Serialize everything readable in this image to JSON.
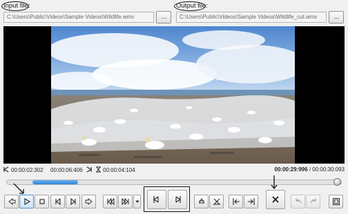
{
  "input": {
    "label": "Input file:",
    "path": "C:\\Users\\Public\\Videos\\Sample Videos\\Wildlife.wmv",
    "browse": "..."
  },
  "output": {
    "label": "Output file:",
    "path": "C:\\Users\\Public\\Videos\\Sample Videos\\Wildlife_cut.wmv",
    "browse": "..."
  },
  "times": {
    "start": "00:00:02:302",
    "end": "00:00:06:406",
    "duration": "00:00:04:104",
    "current": "00:00:29:996",
    "separator": "/",
    "total": "00:00:30:093"
  },
  "seekbar": {
    "selection_start_fraction": 0.077,
    "selection_end_fraction": 0.213,
    "position_fraction": 0.997
  },
  "icons": {
    "prev": "arrow-left-icon",
    "play": "play-icon",
    "stop": "stop-icon",
    "prev_frame": "previous-frame-icon",
    "next_frame": "next-frame-icon",
    "next": "arrow-right-icon",
    "skip_back": "skip-back-icon",
    "skip_forward": "skip-forward-icon",
    "speed": "dropdown-arrow-icon",
    "mark_in": "mark-in-icon",
    "mark_out": "mark-out-icon",
    "save_cut": "save-cut-icon",
    "clear": "clear-marks-icon",
    "go_in": "go-to-in-icon",
    "go_out": "go-to-out-icon",
    "cancel": "close-icon",
    "undo": "undo-icon",
    "redo": "redo-icon",
    "fullscreen": "fullscreen-icon"
  },
  "colors": {
    "accent": "#2e82d6",
    "background": "#f0f0f0"
  }
}
